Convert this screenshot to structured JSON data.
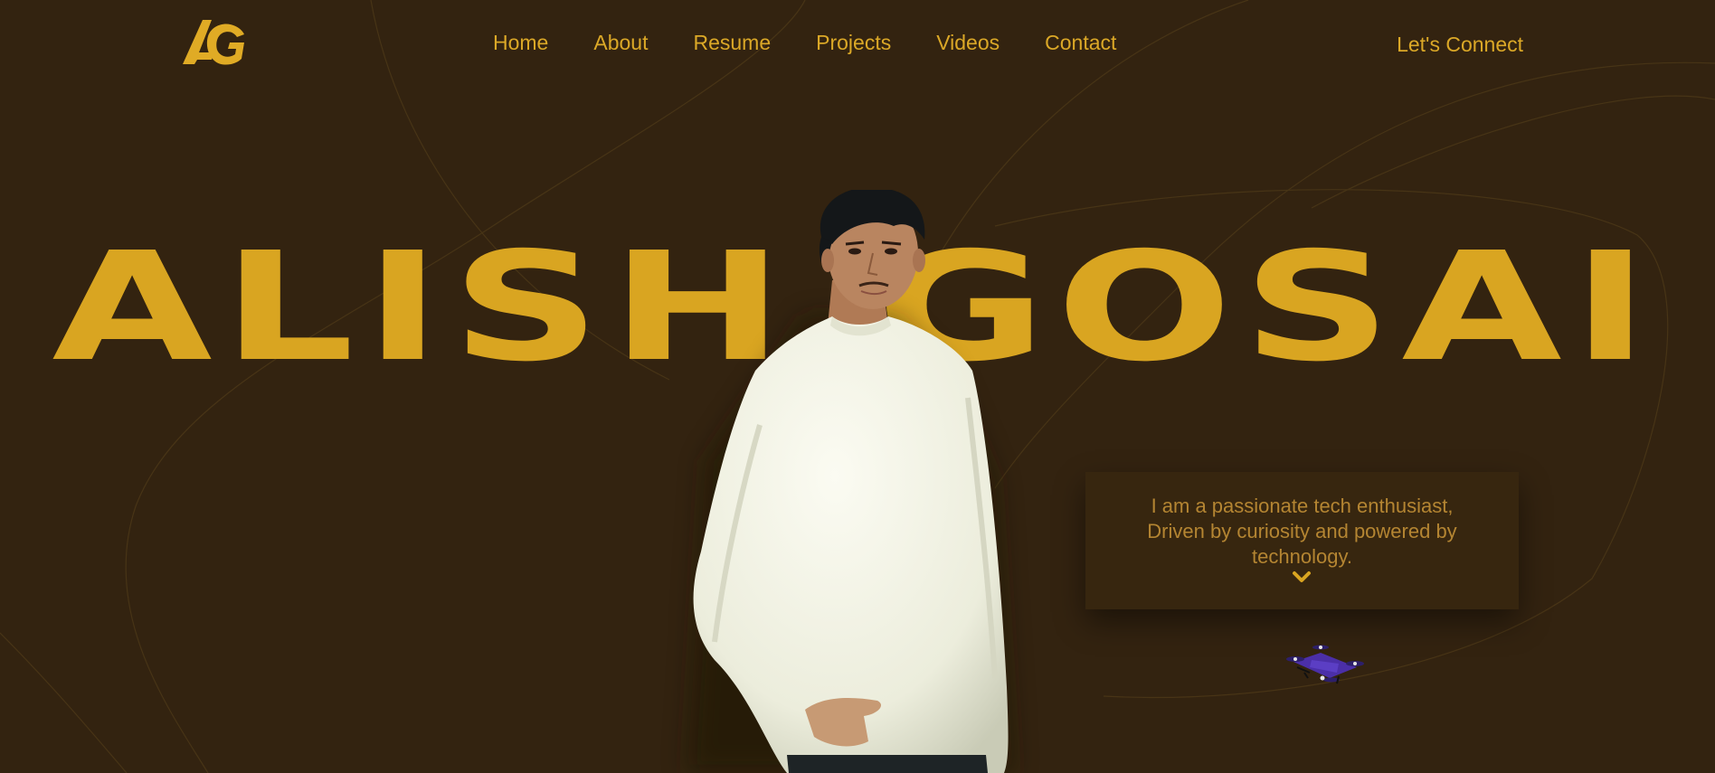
{
  "header": {
    "logo_text": "AG",
    "nav": [
      {
        "label": "Home"
      },
      {
        "label": "About"
      },
      {
        "label": "Resume"
      },
      {
        "label": "Projects"
      },
      {
        "label": "Videos"
      },
      {
        "label": "Contact"
      }
    ],
    "cta_label": "Let's Connect"
  },
  "hero": {
    "name": "ALISH GOSAI"
  },
  "intro": {
    "text": "I am a passionate tech enthusiast, Driven by curiosity and powered by technology.",
    "scroll_icon": "chevron-down-icon"
  },
  "colors": {
    "background": "#332310",
    "accent": "#d9a521",
    "card": "#37260f",
    "intro_text": "#b48532"
  },
  "icons": [
    "logo",
    "chevron-down-icon",
    "drone-icon"
  ]
}
